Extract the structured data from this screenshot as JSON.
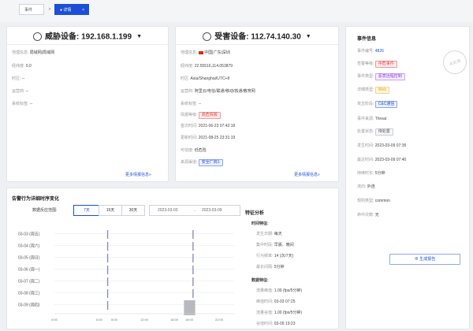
{
  "tabs": {
    "event": "事件",
    "sep": ">",
    "detail": "● 详情",
    "close": "×"
  },
  "threat_device": {
    "title": "威胁设备: 192.168.1.199",
    "rows": [
      {
        "label": "地理信息:",
        "value": "局域网|局域网"
      },
      {
        "label": "经纬度:",
        "value": "0,0"
      },
      {
        "label": "时区:",
        "value": "--"
      },
      {
        "label": "运营商:",
        "value": "--"
      },
      {
        "label": "系统标签:",
        "value": "--"
      }
    ],
    "more": "更多情报信息»"
  },
  "victim_device": {
    "title": "受害设备: 112.74.140.30",
    "rows": [
      {
        "label": "地理信息:",
        "value": "中国|广东|深圳"
      },
      {
        "label": "经纬度:",
        "value": "22.55516,114.053879"
      },
      {
        "label": "时区:",
        "value": "Asia/Shanghai/UTC+8"
      },
      {
        "label": "运营商:",
        "value": "阿里云/电信/联通/移动/铁通/教育网"
      },
      {
        "label": "系统标签:",
        "value": "--"
      }
    ],
    "threat_level_label": "情报等级:",
    "threat_level_value": "高危情报",
    "first_seen_label": "首次时间:",
    "first_seen_value": "2021-06-23 07:42:18",
    "updated_label": "更新时间:",
    "updated_value": "2021-08-25 23:31:19",
    "confidence_label": "可信度:",
    "confidence_value": "低危险",
    "source_label": "来源渠道:",
    "source_value": "安全厂商1",
    "more": "更多情报信息»"
  },
  "chart": {
    "title": "告警行为详细时序变化",
    "range_label": "数据反应范围:",
    "buttons": [
      "7天",
      "15天",
      "30天"
    ],
    "active_button": "7天",
    "date_from": "2023-03-03",
    "date_to": "2023-03-09",
    "date_sep": "→"
  },
  "chart_data": {
    "type": "scatter",
    "title": "告警行为详细时序变化",
    "categories": [
      "03-03 (周五)",
      "03-04 (周六)",
      "03-05 (周日)",
      "03-06 (周一)",
      "03-07 (周二)",
      "03-08 (周三)",
      "03-09 (周四)"
    ],
    "x_ticks": [
      "0:00",
      "6:00",
      "8:00",
      "12:00",
      "16:00",
      "18:00",
      "22:00"
    ],
    "xlim": [
      0,
      24
    ],
    "events": [
      {
        "day": 0,
        "hour": 7.1
      },
      {
        "day": 0,
        "hour": 18.5
      },
      {
        "day": 1,
        "hour": 7.1
      },
      {
        "day": 1,
        "hour": 18.5
      },
      {
        "day": 2,
        "hour": 7.1
      },
      {
        "day": 2,
        "hour": 18.5
      },
      {
        "day": 3,
        "hour": 7.1
      },
      {
        "day": 3,
        "hour": 18.5
      },
      {
        "day": 4,
        "hour": 7.1
      },
      {
        "day": 4,
        "hour": 18.5
      },
      {
        "day": 5,
        "hour": 7.1
      },
      {
        "day": 5,
        "hour": 18.5
      },
      {
        "day": 6,
        "hour": 7.1
      }
    ],
    "highlight": {
      "day": 6,
      "from": 17.3,
      "to": 18.8
    },
    "colors": {
      "event": "#8c8fb8",
      "highlight": "#b7b9be",
      "grid": "#e6e8ee"
    }
  },
  "features": {
    "title": "特征分析",
    "time_title": "时间特征:",
    "time_rows": [
      {
        "label": "发生日期:",
        "value": "每天"
      },
      {
        "label": "集中时段:",
        "value": "早晨、晚间"
      },
      {
        "label": "行为频率:",
        "value": "14 (次/7天)"
      },
      {
        "label": "最长间隔:",
        "value": "5分钟"
      }
    ],
    "data_title": "数据特征:",
    "data_rows": [
      {
        "label": "流量峰值:",
        "value": "1.00 (fps/5分钟)"
      },
      {
        "label": "峰值时间:",
        "value": "03-03 07:25"
      },
      {
        "label": "流量谷值:",
        "value": "1.00 (fps/5分钟)"
      },
      {
        "label": "谷值时间:",
        "value": "03-09 19:23"
      }
    ]
  },
  "event_info": {
    "title": "事件信息",
    "rows": [
      {
        "label": "事件编号:",
        "value": "4826",
        "kind": "link"
      },
      {
        "label": "告警等级:",
        "value": "中危事件",
        "kind": "red"
      },
      {
        "label": "事件类型:",
        "value": "恶意远程控制",
        "kind": "purple"
      },
      {
        "label": "详细类型:",
        "value": "Web",
        "kind": "orange"
      },
      {
        "label": "攻击阶段:",
        "value": "C&C通信",
        "kind": "blue"
      },
      {
        "label": "事件来源:",
        "value": "Threat",
        "kind": "text"
      },
      {
        "label": "处置状态:",
        "value": "待处置",
        "kind": "gray"
      },
      {
        "label": "发生时间:",
        "value": "2023-03-09 07:35",
        "kind": "text"
      },
      {
        "label": "最近时间:",
        "value": "2023-03-09 07:40",
        "kind": "text"
      },
      {
        "label": "持续时长:",
        "value": "5分钟",
        "kind": "text"
      },
      {
        "label": "流向:",
        "value": "外连",
        "kind": "text"
      },
      {
        "label": "规则类型:",
        "value": "common",
        "kind": "text"
      },
      {
        "label": "命中次数:",
        "value": "无",
        "kind": "text"
      }
    ],
    "stamp": "未处理",
    "report_button": "生成报告"
  }
}
